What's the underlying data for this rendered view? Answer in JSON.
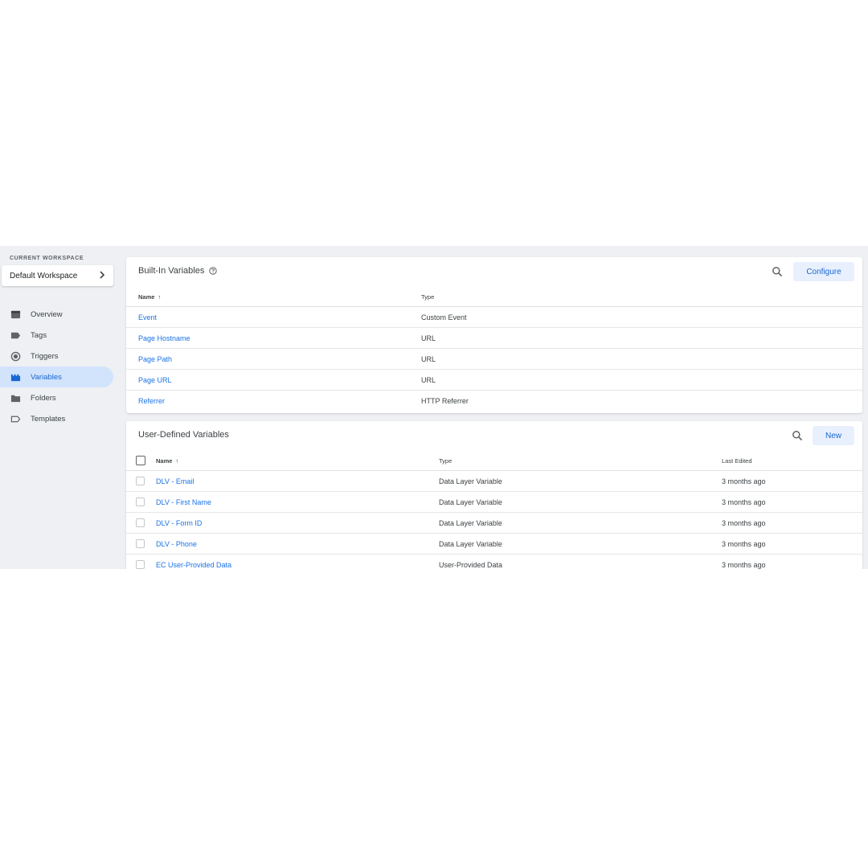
{
  "workspace": {
    "label": "CURRENT WORKSPACE",
    "name": "Default Workspace"
  },
  "nav": [
    {
      "label": "Overview",
      "icon": "overview-icon",
      "active": false
    },
    {
      "label": "Tags",
      "icon": "tag-icon",
      "active": false
    },
    {
      "label": "Triggers",
      "icon": "trigger-icon",
      "active": false
    },
    {
      "label": "Variables",
      "icon": "variables-icon",
      "active": true
    },
    {
      "label": "Folders",
      "icon": "folder-icon",
      "active": false
    },
    {
      "label": "Templates",
      "icon": "template-icon",
      "active": false
    }
  ],
  "builtin": {
    "title": "Built-In Variables",
    "configure_label": "Configure",
    "columns": {
      "name": "Name",
      "type": "Type"
    },
    "rows": [
      {
        "name": "Event",
        "type": "Custom Event"
      },
      {
        "name": "Page Hostname",
        "type": "URL"
      },
      {
        "name": "Page Path",
        "type": "URL"
      },
      {
        "name": "Page URL",
        "type": "URL"
      },
      {
        "name": "Referrer",
        "type": "HTTP Referrer"
      }
    ]
  },
  "userdefined": {
    "title": "User-Defined Variables",
    "new_label": "New",
    "columns": {
      "name": "Name",
      "type": "Type",
      "edited": "Last Edited"
    },
    "rows": [
      {
        "name": "DLV - Email",
        "type": "Data Layer Variable",
        "edited": "3 months ago"
      },
      {
        "name": "DLV - First Name",
        "type": "Data Layer Variable",
        "edited": "3 months ago"
      },
      {
        "name": "DLV - Form ID",
        "type": "Data Layer Variable",
        "edited": "3 months ago"
      },
      {
        "name": "DLV - Phone",
        "type": "Data Layer Variable",
        "edited": "3 months ago"
      },
      {
        "name": "EC User-Provided Data",
        "type": "User-Provided Data",
        "edited": "3 months ago"
      }
    ]
  },
  "colors": {
    "accent": "#1a73e8",
    "active_bg": "#d2e3fc",
    "button_bg": "#e8f0fe",
    "app_bg": "#eef0f3"
  }
}
